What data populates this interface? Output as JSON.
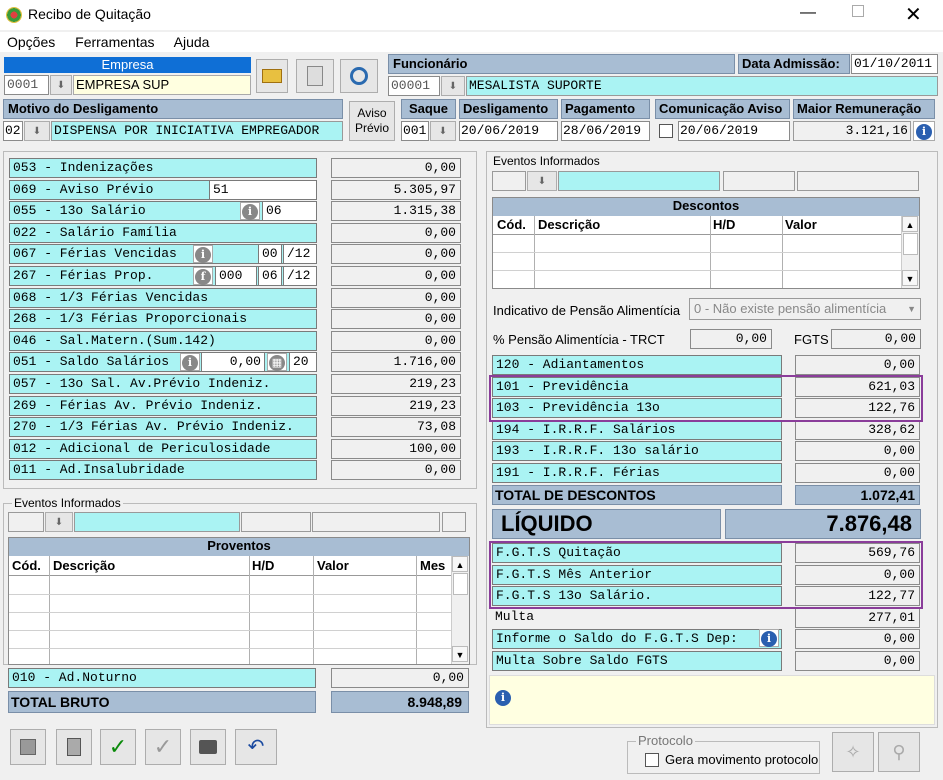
{
  "window": {
    "title": "Recibo de Quitação"
  },
  "menu": [
    "Opções",
    "Ferramentas",
    "Ajuda"
  ],
  "empresa": {
    "label": "Empresa",
    "code": "0001",
    "name": "EMPRESA SUP"
  },
  "funcionario": {
    "label": "Funcionário",
    "code": "00001",
    "name": "MESALISTA SUPORTE"
  },
  "admissao": {
    "label": "Data Admissão:",
    "value": "01/10/2011"
  },
  "motivo": {
    "label": "Motivo do Desligamento",
    "code": "02",
    "desc": "DISPENSA POR INICIATIVA EMPREGADOR"
  },
  "aviso_btn": {
    "line1": "Aviso",
    "line2": "Prévio"
  },
  "saque": {
    "label": "Saque",
    "value": "001"
  },
  "desligamento": {
    "label": "Desligamento",
    "value": "20/06/2019"
  },
  "pagamento": {
    "label": "Pagamento",
    "value": "28/06/2019"
  },
  "comunicacao": {
    "label": "Comunicação Aviso",
    "value": "20/06/2019"
  },
  "maior_rem": {
    "label": "Maior Remuneração",
    "value": "3.121,16"
  },
  "proventos_list": [
    {
      "label": "053 - Indenizações",
      "value": "0,00"
    },
    {
      "label": "069 - Aviso Prévio",
      "extra": "51",
      "value": "5.305,97"
    },
    {
      "label": "055 - 13o Salário",
      "extra": "06",
      "value": "1.315,38"
    },
    {
      "label": "022 - Salário Família",
      "value": "0,00"
    },
    {
      "label": "067 - Férias Vencidas",
      "extra": "00",
      "extra2": "/12",
      "value": "0,00"
    },
    {
      "label": "267 - Férias Prop.",
      "extra0": "000",
      "extra": "06",
      "extra2": "/12",
      "value": "0,00"
    },
    {
      "label": "068 - 1/3 Férias Vencidas",
      "value": "0,00"
    },
    {
      "label": "268 - 1/3 Férias Proporcionais",
      "value": "0,00"
    },
    {
      "label": "046 - Sal.Matern.(Sum.142)",
      "value": "0,00"
    },
    {
      "label": "051 - Saldo Salários",
      "extra0": "0,00",
      "extra": "20",
      "value": "1.716,00"
    },
    {
      "label": "057 - 13o Sal. Av.Prévio Indeniz.",
      "value": "219,23"
    },
    {
      "label": "269 -  Férias  Av. Prévio Indeniz.",
      "value": "219,23"
    },
    {
      "label": "270 - 1/3 Férias Av. Prévio Indeniz.",
      "value": "73,08"
    },
    {
      "label": "012 - Adicional de Periculosidade",
      "value": "100,00"
    },
    {
      "label": "011 - Ad.Insalubridade",
      "value": "0,00"
    }
  ],
  "eventos_left": {
    "label": "Eventos Informados",
    "grid_title": "Proventos",
    "cols": [
      "Cód.",
      "Descrição",
      "H/D",
      "Valor",
      "Mes"
    ]
  },
  "ad_noturno": {
    "label": "010 - Ad.Noturno",
    "value": "0,00"
  },
  "total_bruto": {
    "label": "TOTAL BRUTO",
    "value": "8.948,89"
  },
  "eventos_right": {
    "label": "Eventos Informados",
    "grid_title": "Descontos",
    "cols": [
      "Cód.",
      "Descrição",
      "H/D",
      "Valor"
    ]
  },
  "pensao": {
    "label": "Indicativo de Pensão Alimentícia",
    "value": "0 - Não existe pensão alimentícia",
    "pct_label": "% Pensão Alimentícia - TRCT",
    "pct_value": "0,00",
    "fgts_label": "FGTS",
    "fgts_value": "0,00"
  },
  "descontos_list": [
    {
      "label": "120 - Adiantamentos",
      "value": "0,00"
    },
    {
      "label": "101 - Previdência",
      "value": "621,03"
    },
    {
      "label": "103 - Previdência 13o",
      "value": "122,76"
    },
    {
      "label": "194 - I.R.R.F. Salários",
      "value": "328,62"
    },
    {
      "label": "193 - I.R.R.F. 13o salário",
      "value": "0,00"
    },
    {
      "label": "191 - I.R.R.F. Férias",
      "value": "0,00"
    }
  ],
  "total_descontos": {
    "label": "TOTAL DE DESCONTOS",
    "value": "1.072,41"
  },
  "liquido": {
    "label": "LÍQUIDO",
    "value": "7.876,48"
  },
  "fgts_list": [
    {
      "label": "F.G.T.S  Quitação",
      "value": "569,76"
    },
    {
      "label": "F.G.T.S  Mês Anterior",
      "value": "0,00"
    },
    {
      "label": "F.G.T.S  13o Salário.",
      "value": "122,77"
    },
    {
      "label": "Multa",
      "value": "277,01"
    },
    {
      "label": "Informe o Saldo do F.G.T.S Dep:",
      "value": "0,00"
    },
    {
      "label": "Multa Sobre Saldo FGTS",
      "value": "0,00"
    }
  ],
  "protocolo": {
    "label": "Protocolo",
    "checkbox": "Gera movimento protocolo"
  },
  "colors": {
    "cyan": "#aaf3f3",
    "header": "#a8bdd3",
    "highlight": "#8a3d9a",
    "info_panel": "#ffffe1"
  }
}
